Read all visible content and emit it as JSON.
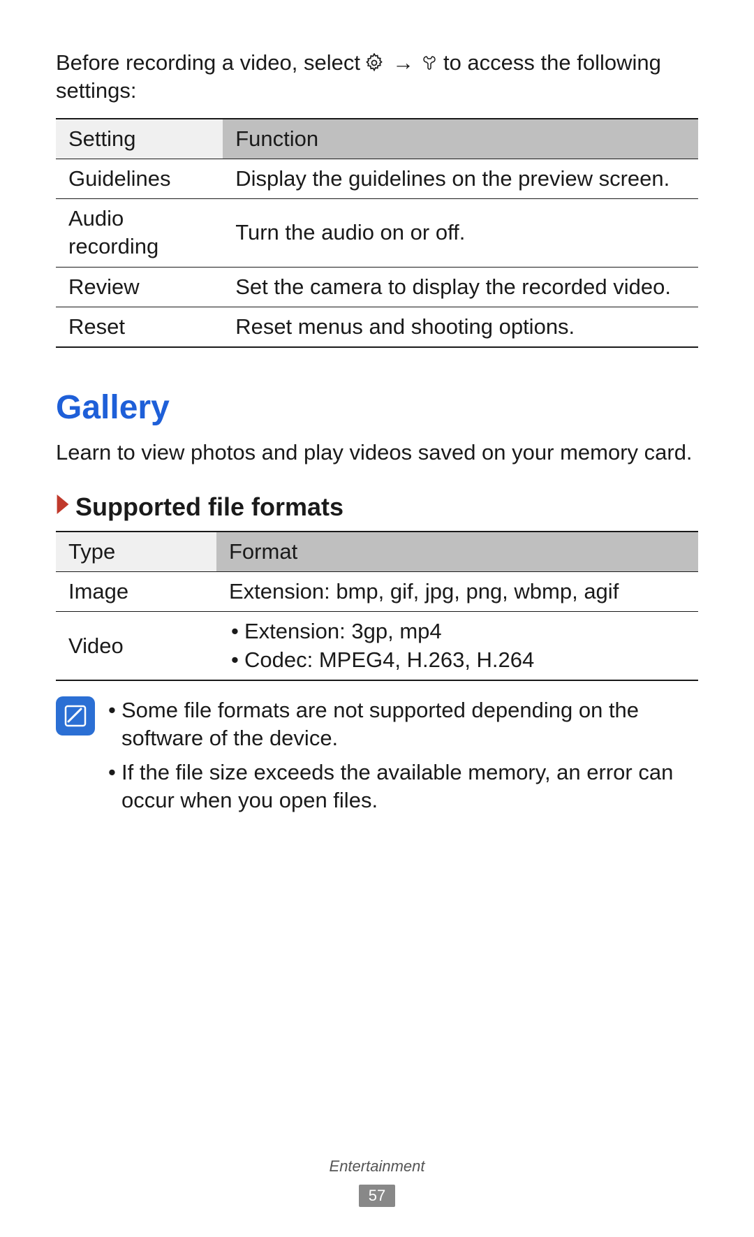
{
  "intro": {
    "before": "Before recording a video, select",
    "after": "to access the following",
    "line2": "settings:"
  },
  "table1": {
    "header": {
      "setting": "Setting",
      "function": "Function"
    },
    "rows": [
      {
        "setting": "Guidelines",
        "function": "Display the guidelines on the preview screen."
      },
      {
        "setting": "Audio recording",
        "function": "Turn the audio on or off."
      },
      {
        "setting": "Review",
        "function": "Set the camera to display the recorded video."
      },
      {
        "setting": "Reset",
        "function": "Reset menus and shooting options."
      }
    ]
  },
  "gallery": {
    "title": "Gallery",
    "desc": "Learn to view photos and play videos saved on your memory card.",
    "subsection": "Supported file formats"
  },
  "table2": {
    "header": {
      "type": "Type",
      "format": "Format"
    },
    "rows": {
      "image": {
        "type": "Image",
        "format": "Extension: bmp, gif, jpg, png, wbmp, agif"
      },
      "video": {
        "type": "Video",
        "bullets": [
          "Extension: 3gp, mp4",
          "Codec: MPEG4, H.263, H.264"
        ]
      }
    }
  },
  "notes": [
    "Some file formats are not supported depending on the software of the device.",
    "If the file size exceeds the available memory, an error can occur when you open files."
  ],
  "footer": {
    "category": "Entertainment",
    "page": "57"
  }
}
